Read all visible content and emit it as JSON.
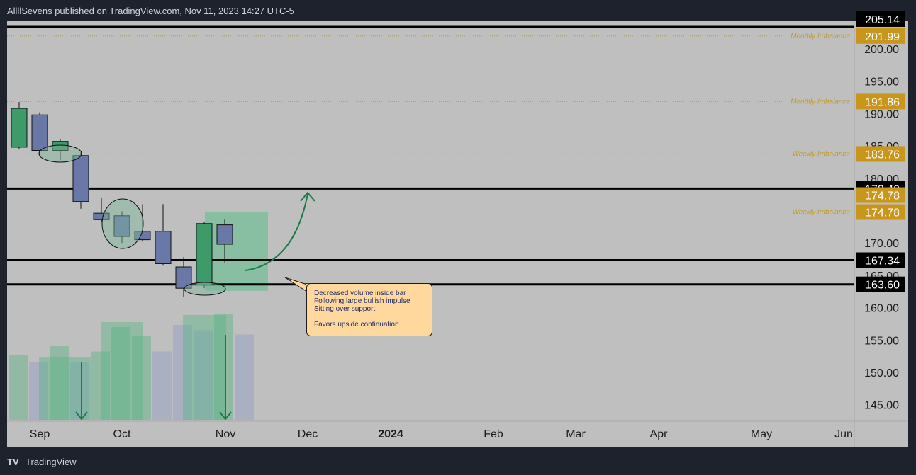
{
  "header": {
    "published_text": "AllllSevens published on TradingView.com, Nov 11, 2023 14:27 UTC-5"
  },
  "footer": {
    "brand": "TradingView",
    "logo_mark": "TV"
  },
  "colors": {
    "background": "#bfbfbf",
    "frame": "#1e222d",
    "bull_candle": "#3e9a6a",
    "bear_candle": "#6a78a8",
    "imbalance_label": "#c29a2a",
    "imbalance_badge": "#c8961c",
    "level_badge": "#000000",
    "callout_fill": "#ffd89e",
    "arrow": "#1f7a48"
  },
  "chart_data": {
    "type": "candlestick",
    "x_tick_labels": [
      "Sep",
      "Oct",
      "Nov",
      "Dec",
      "2024",
      "Feb",
      "Mar",
      "Apr",
      "May",
      "Jun"
    ],
    "y_tick_labels": [
      "145.00",
      "150.00",
      "155.00",
      "160.00",
      "165.00",
      "170.00",
      "175.00",
      "180.00",
      "185.00",
      "190.00",
      "195.00",
      "200.00",
      "205.00"
    ],
    "ylim": [
      142.5,
      206
    ],
    "candles": [
      {
        "open": 184.8,
        "high": 191.8,
        "low": 184.5,
        "close": 190.8
      },
      {
        "open": 189.8,
        "high": 190.2,
        "low": 183.5,
        "close": 184.3
      },
      {
        "open": 184.3,
        "high": 186.0,
        "low": 182.8,
        "close": 185.7
      },
      {
        "open": 183.5,
        "high": 184.0,
        "low": 175.3,
        "close": 176.4
      },
      {
        "open": 174.6,
        "high": 177.0,
        "low": 173.2,
        "close": 173.6
      },
      {
        "open": 174.2,
        "high": 174.9,
        "low": 170.0,
        "close": 171.0
      },
      {
        "open": 171.8,
        "high": 176.0,
        "low": 170.2,
        "close": 170.5
      },
      {
        "open": 171.8,
        "high": 176.0,
        "low": 166.5,
        "close": 166.8
      },
      {
        "open": 166.3,
        "high": 167.8,
        "low": 161.7,
        "close": 163.0
      },
      {
        "open": 163.5,
        "high": 173.2,
        "low": 163.0,
        "close": 173.0
      },
      {
        "open": 172.8,
        "high": 173.6,
        "low": 167.0,
        "close": 169.8
      }
    ],
    "volume_relative": [
      0.62,
      0.55,
      0.7,
      0.55,
      0.65,
      0.88,
      0.8,
      0.65,
      0.9,
      0.85,
      1.0,
      0.81
    ],
    "volume_bull": [
      true,
      false,
      true,
      false,
      true,
      true,
      true,
      false,
      false,
      false,
      true,
      false
    ],
    "horizontal_levels": [
      {
        "value": 178.4,
        "label": "178.40",
        "style": "solid"
      },
      {
        "value": 167.34,
        "label": "167.34",
        "style": "solid"
      },
      {
        "value": 163.6,
        "label": "163.60",
        "style": "solid"
      },
      {
        "value": 205.14,
        "label": "205.14",
        "style": "solid"
      }
    ],
    "imbalance_levels": [
      {
        "value": 201.99,
        "label": "201.99",
        "text": "Monthly Imbalance"
      },
      {
        "value": 191.86,
        "label": "191.86",
        "text": "Monthly Imbalance"
      },
      {
        "value": 183.76,
        "label": "183.76",
        "text": "Weekly Imbalance"
      },
      {
        "value": 174.78,
        "label": "174.78",
        "text": "Weekly Imbalance"
      }
    ],
    "extra_badges": [
      {
        "value": 174.78,
        "label": "174.78"
      }
    ],
    "highlight_zone": {
      "y_top": 174.8,
      "y_bottom": 162.6
    },
    "annotation": {
      "lines": [
        "Decreased volume inside bar",
        "Following large bullish impulse",
        "Sitting over support",
        "",
        "Favors upside continuation"
      ]
    }
  }
}
